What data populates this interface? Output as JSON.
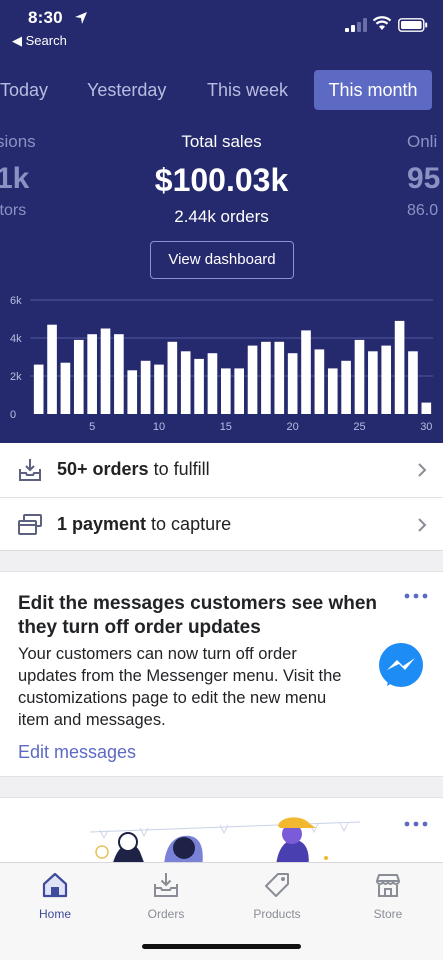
{
  "status_bar": {
    "time": "8:30",
    "back_label": "◀ Search"
  },
  "periods": [
    "Today",
    "Yesterday",
    "This week",
    "This month"
  ],
  "active_period": "This month",
  "metrics": {
    "left": {
      "label": "sions",
      "value": "1k",
      "sub": "itors"
    },
    "main": {
      "label": "Total sales",
      "value": "$100.03k",
      "sub": "2.44k orders"
    },
    "right": {
      "label": "Onli",
      "value": "95",
      "sub": "86.0"
    }
  },
  "dashboard_button": "View dashboard",
  "chart_data": {
    "type": "bar",
    "x": [
      1,
      2,
      3,
      4,
      5,
      6,
      7,
      8,
      9,
      10,
      11,
      12,
      13,
      14,
      15,
      16,
      17,
      18,
      19,
      20,
      21,
      22,
      23,
      24,
      25,
      26,
      27,
      28,
      29,
      30
    ],
    "values": [
      2600,
      4700,
      2700,
      3900,
      4200,
      4500,
      4200,
      2300,
      2800,
      2600,
      3800,
      3300,
      2900,
      3200,
      2400,
      2400,
      3600,
      3800,
      3800,
      3200,
      4400,
      3400,
      2400,
      2800,
      3900,
      3300,
      3600,
      4900,
      3300,
      600
    ],
    "x_ticks": [
      5,
      10,
      15,
      20,
      25,
      30
    ],
    "y_ticks": [
      "0",
      "2k",
      "4k",
      "6k"
    ],
    "ylim": [
      0,
      6000
    ],
    "xlabel": "",
    "ylabel": "",
    "grid": true,
    "colors": {
      "bar": "#ffffff",
      "grid": "#5058a0",
      "tick": "#b8bce0"
    }
  },
  "actions": [
    {
      "bold": "50+ orders",
      "rest": " to fulfill",
      "icon": "fulfill-icon"
    },
    {
      "bold": "1 payment",
      "rest": " to capture",
      "icon": "payment-icon"
    }
  ],
  "card": {
    "title": "Edit the messages customers see when they turn off order updates",
    "body": "Your customers can now turn off order updates from the Messenger menu. Visit the customizations page to edit the new menu item and messages.",
    "link": "Edit messages",
    "icon": "messenger-icon"
  },
  "tabs": [
    {
      "label": "Home",
      "icon": "home-icon",
      "active": true
    },
    {
      "label": "Orders",
      "icon": "orders-icon",
      "active": false
    },
    {
      "label": "Products",
      "icon": "tag-icon",
      "active": false
    },
    {
      "label": "Store",
      "icon": "store-icon",
      "active": false
    }
  ],
  "colors": {
    "navy": "#252a6e",
    "accent": "#5c6ac4",
    "link": "#5c6ac4"
  }
}
